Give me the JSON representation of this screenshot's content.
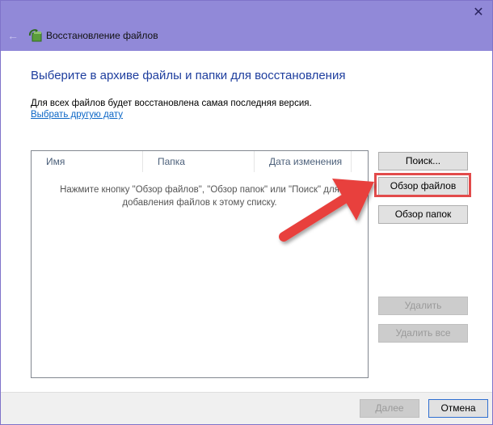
{
  "window": {
    "title": "Восстановление файлов",
    "close_glyph": "✕",
    "back_glyph": "←"
  },
  "main": {
    "heading": "Выберите в архиве файлы и папки для восстановления",
    "info": "Для всех файлов будет восстановлена самая последняя версия.",
    "link": "Выбрать другую дату"
  },
  "list": {
    "columns": [
      "Имя",
      "Папка",
      "Дата изменения"
    ],
    "empty_line1": "Нажмите кнопку \"Обзор файлов\", \"Обзор папок\" или \"Поиск\" для",
    "empty_line2": "добавления файлов к этому списку."
  },
  "buttons": {
    "search": "Поиск...",
    "browse_files": "Обзор файлов",
    "browse_folders": "Обзор папок",
    "remove": "Удалить",
    "remove_all": "Удалить все",
    "next": "Далее",
    "cancel": "Отмена"
  },
  "colors": {
    "titlebar": "#9189d8",
    "highlight": "#e24b4b",
    "heading": "#1e3e9e",
    "link": "#0b66c6"
  }
}
